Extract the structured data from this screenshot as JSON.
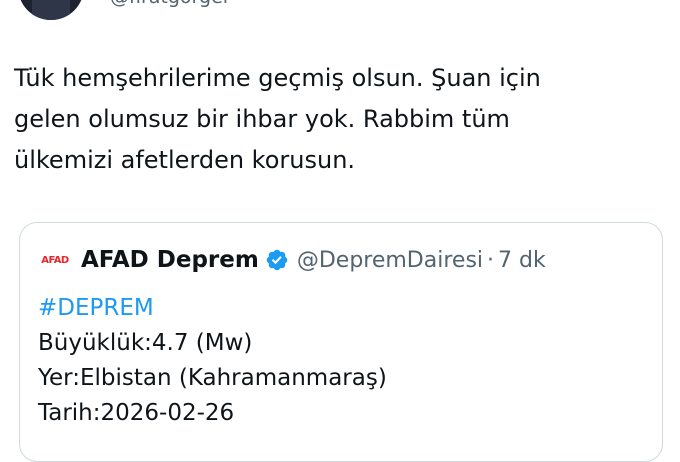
{
  "tweet": {
    "handle": "@firatgorgel",
    "text_lines": [
      "Tük hemşehrilerime geçmiş olsun. Şuan için",
      "gelen olumsuz bir ihbar yok. Rabbim tüm",
      "ülkemizi afetlerden korusun."
    ]
  },
  "quote": {
    "logo_text": "AFAD",
    "name": "AFAD Deprem",
    "verified": true,
    "handle": "@DepremDairesi",
    "separator": "·",
    "time": "7 dk",
    "hashtag": "#DEPREM",
    "lines": [
      "Büyüklük:4.7 (Mw)",
      "Yer:Elbistan (Kahramanmaraş)",
      "Tarih:2026-02-26"
    ]
  },
  "colors": {
    "text": "#0f1419",
    "secondary": "#536471",
    "link": "#1d9bf0",
    "border": "#cfd9de",
    "verified": "#1d9bf0",
    "afad_red": "#e3262b"
  },
  "icons": {
    "verified": "verified-badge-icon"
  }
}
